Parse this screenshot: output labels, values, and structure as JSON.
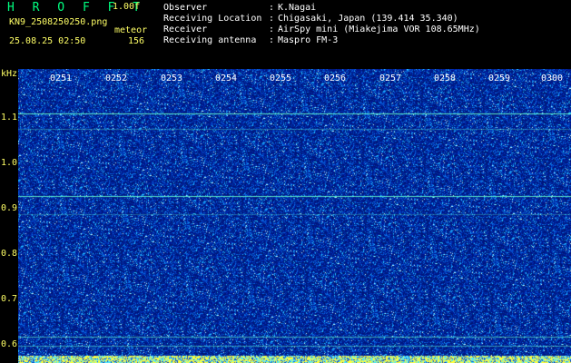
{
  "header": {
    "app_name": "H R O F F T",
    "version": "1.00f",
    "filename": "KN9_2508250250.png",
    "mode": "meteor",
    "datetime": "25.08.25 02:50",
    "count": "156"
  },
  "meta": {
    "observer_label": "Observer",
    "observer_value": "K.Nagai",
    "location_label": "Receiving Location",
    "location_value": "Chigasaki, Japan (139.414 35.340)",
    "receiver_label": "Receiver",
    "receiver_value": "AirSpy mini (Miakejima VOR 108.65MHz)",
    "antenna_label": "Receiving antenna",
    "antenna_value": "Maspro FM-3",
    "colon": ":"
  },
  "axis": {
    "unit": "kHz",
    "y_ticks": [
      "1.1",
      "1.0",
      "0.9",
      "0.8",
      "0.7",
      "0.6"
    ],
    "time_ticks": [
      "0251",
      "0252",
      "0253",
      "0254",
      "0255",
      "0256",
      "0257",
      "0258",
      "0259",
      "0300"
    ]
  },
  "colors": {
    "background": "#000000",
    "waterfall_base": "#001a8c",
    "header_text": "#ffff66",
    "app_name": "#00ff80",
    "signal_line": "#66ffcc"
  }
}
